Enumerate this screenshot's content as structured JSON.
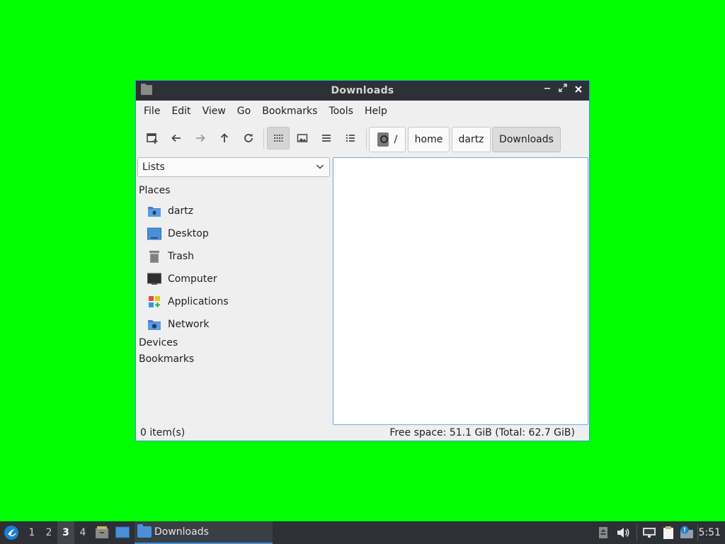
{
  "window": {
    "title": "Downloads",
    "buttons": {
      "minimize": "–",
      "maximize": "⤢",
      "close": "✕"
    }
  },
  "menubar": {
    "items": [
      "File",
      "Edit",
      "View",
      "Go",
      "Bookmarks",
      "Tools",
      "Help"
    ]
  },
  "toolbar": {
    "buttons": [
      {
        "name": "new-tab-button",
        "icon": "new-tab-icon"
      },
      {
        "name": "back-button",
        "icon": "arrow-left-icon"
      },
      {
        "name": "forward-button",
        "icon": "arrow-right-icon"
      },
      {
        "name": "up-button",
        "icon": "arrow-up-icon"
      },
      {
        "name": "reload-button",
        "icon": "reload-icon"
      },
      {
        "name": "icon-view-button",
        "icon": "grid-icon",
        "active": true
      },
      {
        "name": "thumbnail-view-button",
        "icon": "image-icon"
      },
      {
        "name": "compact-view-button",
        "icon": "compact-list-icon"
      },
      {
        "name": "detailed-view-button",
        "icon": "detailed-list-icon"
      }
    ],
    "path": {
      "root": "/",
      "segments": [
        "home",
        "dartz",
        "Downloads"
      ]
    }
  },
  "side_panel": {
    "selector": "Lists",
    "places_title": "Places",
    "places": [
      {
        "label": "dartz",
        "icon": "home-folder-icon"
      },
      {
        "label": "Desktop",
        "icon": "desktop-icon"
      },
      {
        "label": "Trash",
        "icon": "trash-icon"
      },
      {
        "label": "Computer",
        "icon": "computer-icon"
      },
      {
        "label": "Applications",
        "icon": "applications-icon"
      },
      {
        "label": "Network",
        "icon": "network-icon"
      }
    ],
    "devices_title": "Devices",
    "bookmarks_title": "Bookmarks"
  },
  "statusbar": {
    "items": "0 item(s)",
    "free_space": "Free space: 51.1 GiB (Total: 62.7 GiB)"
  },
  "taskbar": {
    "workspaces": [
      "1",
      "2",
      "3",
      "4"
    ],
    "active_workspace": "3",
    "task_label": "Downloads",
    "clock": "5:51"
  },
  "colors": {
    "desktop": "#00ff00",
    "titlebar": "#2d3035",
    "accent": "#3a90d8"
  }
}
